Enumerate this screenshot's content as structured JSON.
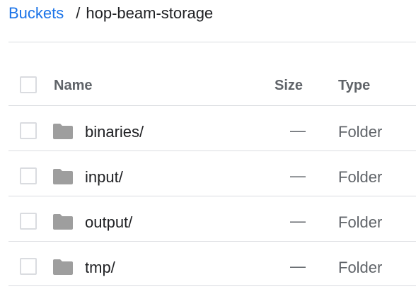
{
  "breadcrumb": {
    "root": "Buckets",
    "separator": "/",
    "current": "hop-beam-storage"
  },
  "table": {
    "columns": {
      "name": "Name",
      "size": "Size",
      "type": "Type"
    },
    "rows": [
      {
        "name": "binaries/",
        "size": "—",
        "type": "Folder",
        "icon": "folder-icon"
      },
      {
        "name": "input/",
        "size": "—",
        "type": "Folder",
        "icon": "folder-icon"
      },
      {
        "name": "output/",
        "size": "—",
        "type": "Folder",
        "icon": "folder-icon"
      },
      {
        "name": "tmp/",
        "size": "—",
        "type": "Folder",
        "icon": "folder-icon"
      }
    ]
  },
  "colors": {
    "link": "#1a73e8",
    "text": "#202124",
    "muted": "#5f6368",
    "divider": "#dadce0",
    "folder_icon": "#9e9e9e"
  }
}
